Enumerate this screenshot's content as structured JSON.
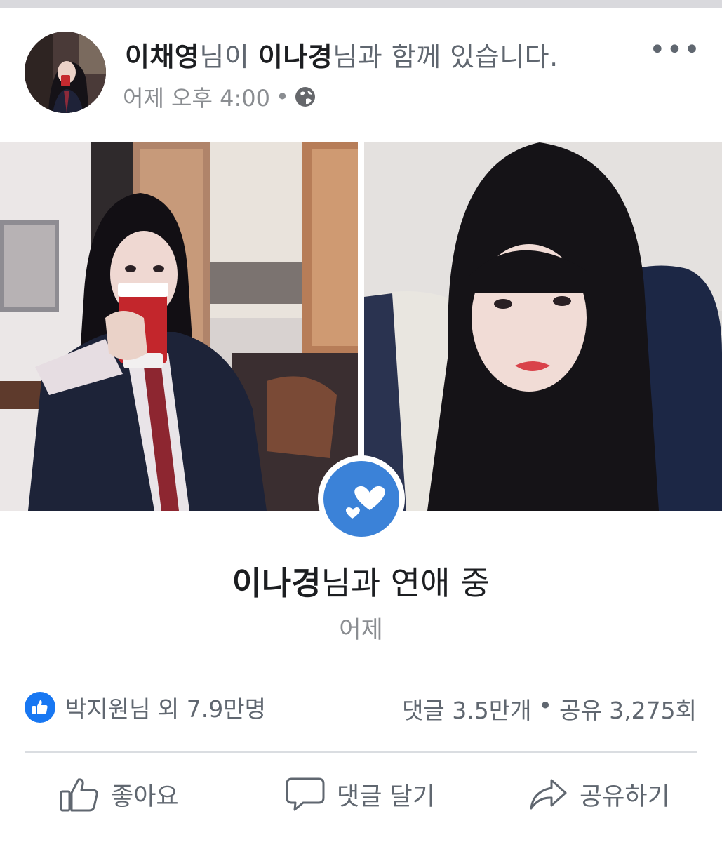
{
  "header": {
    "author": "이채영",
    "suffix_1": "님이 ",
    "tagged": "이나경",
    "suffix_2": "님과 함께 있습니다.",
    "timestamp": "어제 오후 4:00",
    "separator": "•",
    "more_label": "•••"
  },
  "life_event": {
    "name": "이나경",
    "text": "님과 연애 중",
    "date": "어제"
  },
  "stats": {
    "likes": "박지원님 외 7.9만명",
    "comments": "댓글 3.5만개",
    "separator": "•",
    "shares": "공유 3,275회"
  },
  "actions": {
    "like": "좋아요",
    "comment": "댓글 달기",
    "share": "공유하기"
  },
  "colors": {
    "accent": "#1877f2",
    "badge": "#3b82d8",
    "text_secondary": "#606770",
    "text_primary": "#1c1e21"
  },
  "icons": [
    "globe-icon",
    "hearts-icon",
    "like-icon",
    "thumbs-up-icon",
    "comment-icon",
    "share-icon",
    "more-icon"
  ]
}
